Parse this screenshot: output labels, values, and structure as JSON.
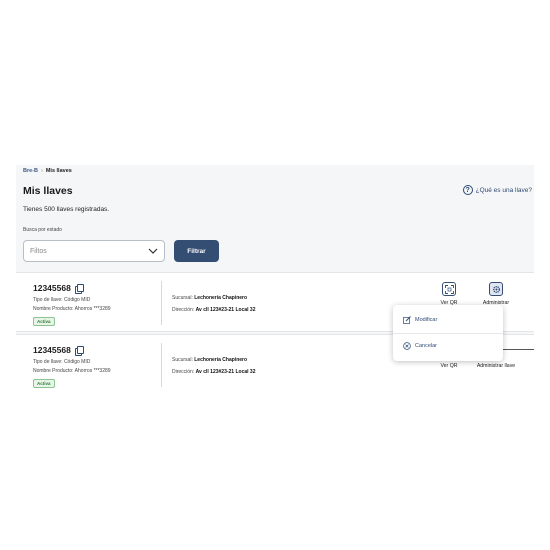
{
  "breadcrumb": {
    "root": "Bre-B",
    "separator": "›",
    "current": "Mis llaves"
  },
  "page": {
    "title": "Mis llaves",
    "help_link": "¿Qué es una llave?",
    "count_text": "Tienes 500 llaves registradas."
  },
  "filter": {
    "label": "Busca por estado",
    "placeholder": "Filtos",
    "button": "Filtrar"
  },
  "cards": [
    {
      "id": "12345568",
      "tipo": "Tipo de llave: Código MID",
      "producto": "Nombre Producto: Ahorros ***3289",
      "status": "Activa",
      "sucursal_label": "Sucursal:",
      "sucursal": "Lechonería Chapinero",
      "direccion_label": "Dirección:",
      "direccion": "Av cll 123#23-21 Local 32",
      "qr_label": "Ver QR",
      "admin_label": "Administrar"
    },
    {
      "id": "12345568",
      "tipo": "Tipo de llave: Código MID",
      "producto": "Nombre Producto: Ahorros ***3289",
      "status": "Activa",
      "sucursal_label": "Sucursal:",
      "sucursal": "Lechonería Chapinero",
      "direccion_label": "Dirección:",
      "direccion": "Av cll 123#23-21 Local 32",
      "qr_label": "Ver QR",
      "admin_label": "Administrar llave"
    }
  ],
  "menu": {
    "modify": "Modificar",
    "cancel": "Cancelar"
  },
  "colors": {
    "primary": "#344d72",
    "link": "#2d4a74",
    "active_badge": "#2e7d32",
    "background": "#f5f6f7"
  }
}
